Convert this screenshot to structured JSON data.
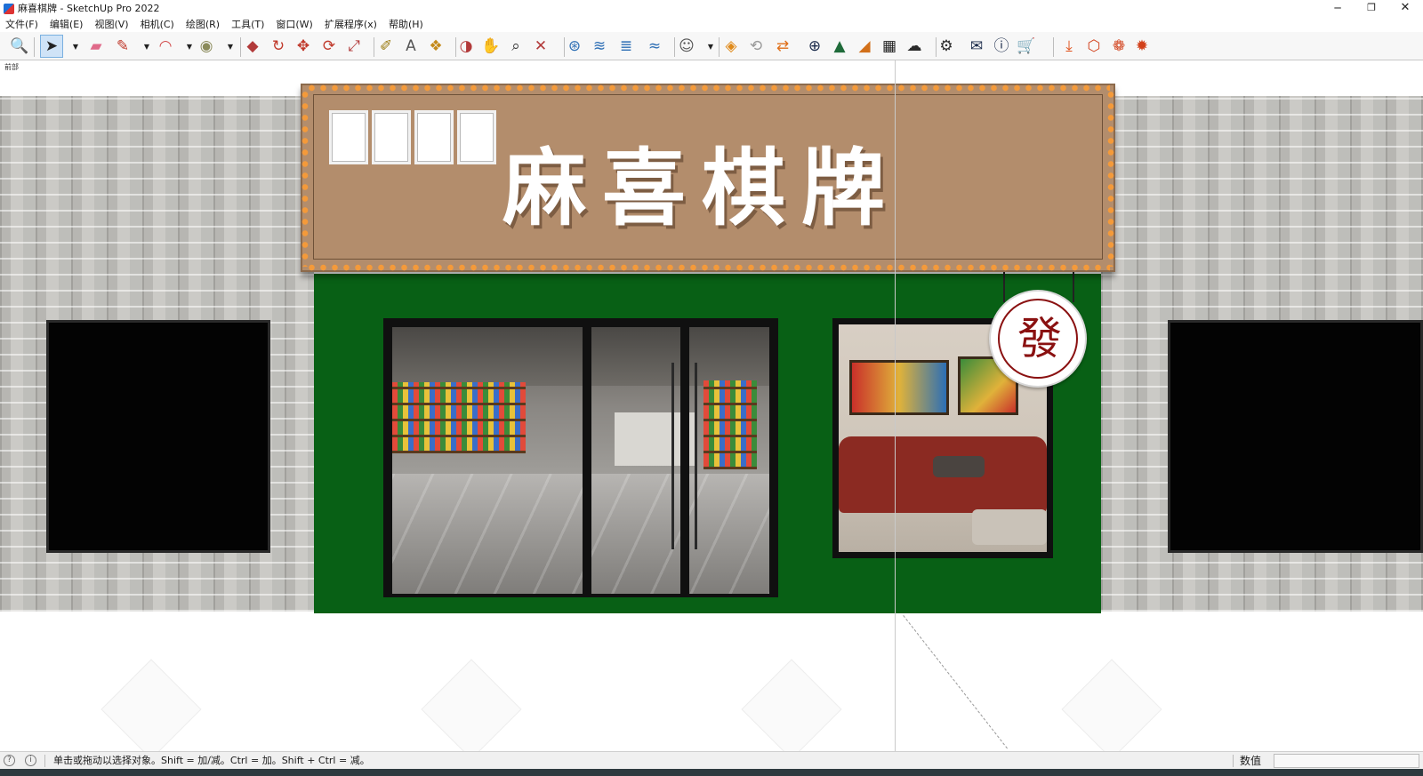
{
  "window": {
    "title": "麻喜棋牌 - SketchUp Pro 2022",
    "controls": {
      "minimize": "─",
      "maximize": "❐",
      "close": "✕"
    }
  },
  "menubar": {
    "items": [
      "文件(F)",
      "编辑(E)",
      "视图(V)",
      "相机(C)",
      "绘图(R)",
      "工具(T)",
      "窗口(W)",
      "扩展程序(x)",
      "帮助(H)"
    ]
  },
  "toolbar": {
    "tools": [
      {
        "name": "search-tool",
        "glyph": "🔍",
        "color": "#333333"
      },
      {
        "name": "select-tool",
        "glyph": "➤",
        "color": "#222222"
      },
      {
        "name": "eraser-tool",
        "glyph": "▰",
        "color": "#e06a8a"
      },
      {
        "name": "pencil-tool",
        "glyph": "✎",
        "color": "#c0392b"
      },
      {
        "name": "arc-tool",
        "glyph": "◠",
        "color": "#d24a4a"
      },
      {
        "name": "shape-tool",
        "glyph": "◉",
        "color": "#8a8a5a"
      },
      {
        "name": "pushpull-tool",
        "glyph": "◆",
        "color": "#b23a3a"
      },
      {
        "name": "followme-tool",
        "glyph": "↻",
        "color": "#c0392b"
      },
      {
        "name": "move-tool",
        "glyph": "✥",
        "color": "#c0392b"
      },
      {
        "name": "rotate-tool",
        "glyph": "⟳",
        "color": "#c0392b"
      },
      {
        "name": "scale-tool",
        "glyph": "⤢",
        "color": "#b23a3a"
      },
      {
        "name": "tape-tool",
        "glyph": "✐",
        "color": "#9a7a10"
      },
      {
        "name": "text-tool",
        "glyph": "A",
        "color": "#555555"
      },
      {
        "name": "paint-tool",
        "glyph": "❖",
        "color": "#c48a1a"
      },
      {
        "name": "orbit-tool",
        "glyph": "◑",
        "color": "#b23a3a"
      },
      {
        "name": "pan-tool",
        "glyph": "✋",
        "color": "#c48a1a"
      },
      {
        "name": "zoom-tool",
        "glyph": "⌕",
        "color": "#333333"
      },
      {
        "name": "zoom-extents-tool",
        "glyph": "✕",
        "color": "#b23a3a"
      },
      {
        "name": "sandbox-tool-1",
        "glyph": "⊛",
        "color": "#2e6fb5"
      },
      {
        "name": "sandbox-tool-2",
        "glyph": "≋",
        "color": "#2e6fb5"
      },
      {
        "name": "sandbox-tool-3",
        "glyph": "≣",
        "color": "#2e6fb5"
      },
      {
        "name": "sandbox-tool-4",
        "glyph": "≈",
        "color": "#2e6fb5"
      },
      {
        "name": "account-tool",
        "glyph": "☺",
        "color": "#555555"
      },
      {
        "name": "warehouse-tool",
        "glyph": "◈",
        "color": "#e08a1a"
      },
      {
        "name": "refresh-tool",
        "glyph": "⟲",
        "color": "#9a9a9a"
      },
      {
        "name": "transfer-tool",
        "glyph": "⇄",
        "color": "#e0701a"
      },
      {
        "name": "add-tool",
        "glyph": "⊕",
        "color": "#1a2a4a"
      },
      {
        "name": "tree-tool",
        "glyph": "▲",
        "color": "#1f6b3a"
      },
      {
        "name": "layer-tool",
        "glyph": "◢",
        "color": "#d2701a"
      },
      {
        "name": "checker-tool",
        "glyph": "▦",
        "color": "#222222"
      },
      {
        "name": "cloud-tool",
        "glyph": "☁",
        "color": "#2a2a2a"
      },
      {
        "name": "settings-tool",
        "glyph": "⚙",
        "color": "#2a2a2a"
      },
      {
        "name": "mail-tool",
        "glyph": "✉",
        "color": "#1a2a4a"
      },
      {
        "name": "info-tool",
        "glyph": "ⓘ",
        "color": "#1a2a4a"
      },
      {
        "name": "cart-tool",
        "glyph": "🛒",
        "color": "#1a2a4a"
      },
      {
        "name": "import-tool",
        "glyph": "⤓",
        "color": "#e0501a"
      },
      {
        "name": "export-tool",
        "glyph": "⬡",
        "color": "#d2401a"
      },
      {
        "name": "render-tool",
        "glyph": "❁",
        "color": "#d2401a"
      },
      {
        "name": "render-settings-tool",
        "glyph": "✹",
        "color": "#d2401a"
      }
    ]
  },
  "viewport": {
    "scene_label": "前部",
    "signboard_title": "麻喜棋牌",
    "hanging_sign_char": "發"
  },
  "statusbar": {
    "hint": "单击或拖动以选择对象。Shift = 加/减。Ctrl = 加。Shift + Ctrl = 减。",
    "measurements_label": "数值",
    "measurements_value": ""
  },
  "colors": {
    "storefront_green": "#086015",
    "signboard_tan": "#b38d6c",
    "bulb_orange": "#f49a3a",
    "fa_red": "#8a1111"
  }
}
